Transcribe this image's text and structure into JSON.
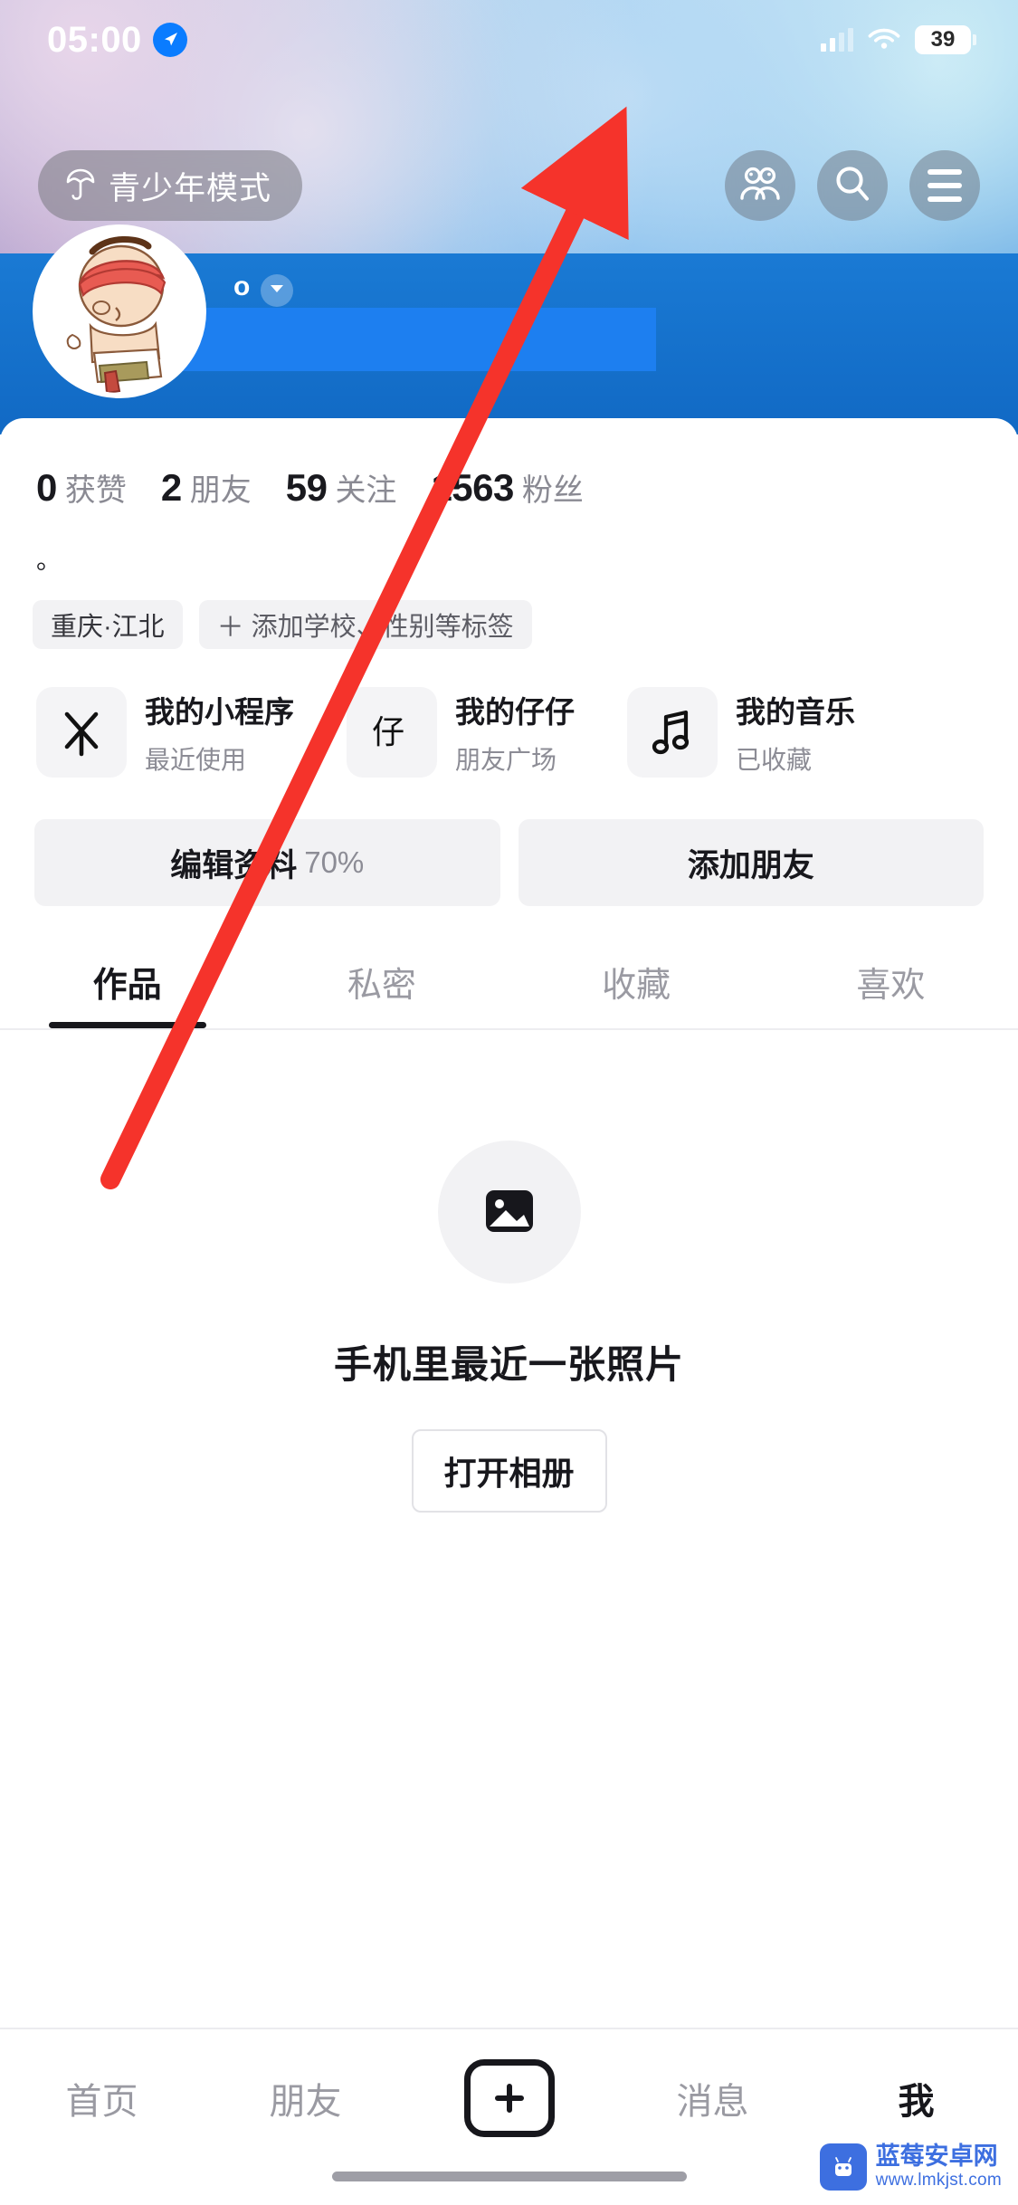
{
  "status_bar": {
    "time": "05:00",
    "location_icon": "location-arrow-icon",
    "signal_icon": "cellular-signal-icon",
    "wifi_icon": "wifi-icon",
    "battery_level": "39"
  },
  "header": {
    "teen_mode_label": "青少年模式",
    "teen_mode_icon": "umbrella-icon",
    "friends_icon": "two-people-icon",
    "search_icon": "search-icon",
    "menu_icon": "hamburger-menu-icon"
  },
  "profile": {
    "avatar_icon": "cartoon-avatar",
    "name_redacted": "",
    "dot_mark": "o",
    "chevron_icon": "chevron-down-icon",
    "signature": "。",
    "stats": [
      {
        "value": "0",
        "label": "获赞"
      },
      {
        "value": "2",
        "label": "朋友"
      },
      {
        "value": "59",
        "label": "关注"
      },
      {
        "value": "1563",
        "label": "粉丝"
      }
    ],
    "tags": [
      {
        "text": "重庆·江北",
        "has_plus": false
      },
      {
        "text": "添加学校、性别等标签",
        "has_plus": true
      }
    ]
  },
  "entry_cards": [
    {
      "icon": "douyin-logo-icon",
      "title": "我的小程序",
      "subtitle": "最近使用"
    },
    {
      "icon": "zaizai-icon",
      "title": "我的仔仔",
      "subtitle": "朋友广场"
    },
    {
      "icon": "music-note-icon",
      "title": "我的音乐",
      "subtitle": "已收藏"
    }
  ],
  "actions": {
    "edit_profile_label": "编辑资料",
    "edit_profile_percent": "70%",
    "add_friend_label": "添加朋友"
  },
  "tabs": [
    {
      "label": "作品",
      "active": true
    },
    {
      "label": "私密",
      "active": false
    },
    {
      "label": "收藏",
      "active": false
    },
    {
      "label": "喜欢",
      "active": false
    }
  ],
  "empty_state": {
    "icon": "photo-placeholder-icon",
    "title": "手机里最近一张照片",
    "button_label": "打开相册"
  },
  "bottom_nav": [
    {
      "label": "首页",
      "active": false
    },
    {
      "label": "朋友",
      "active": false
    },
    {
      "label": "",
      "active": false,
      "icon": "plus-create-icon"
    },
    {
      "label": "消息",
      "active": false
    },
    {
      "label": "我",
      "active": true
    }
  ],
  "watermark": {
    "site_name": "蓝莓安卓网",
    "site_url": "www.lmkjst.com",
    "logo_icon": "android-robot-icon"
  },
  "annotation": {
    "arrow_color": "#f5332b",
    "arrow_description": "red-arrow-pointing-to-hamburger-menu"
  }
}
